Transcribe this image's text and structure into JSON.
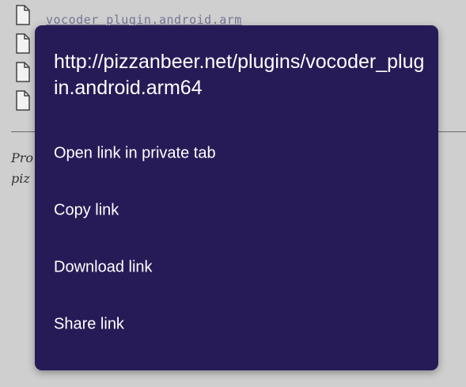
{
  "background_page": {
    "file_link_text": "vocoder_plugin.android.arm",
    "file_icon": "file-icon",
    "text_line_1": "Pro",
    "text_line_2": "piz"
  },
  "dialog": {
    "title": "http://pizzanbeer.net/plugins/vocoder_plugin.android.arm64",
    "items": [
      {
        "label": "Open link in private tab"
      },
      {
        "label": "Copy link"
      },
      {
        "label": "Download link"
      },
      {
        "label": "Share link"
      }
    ]
  },
  "colors": {
    "dialog_background": "#271b57",
    "scrim": "#cfcfcf",
    "text": "#ffffff"
  }
}
